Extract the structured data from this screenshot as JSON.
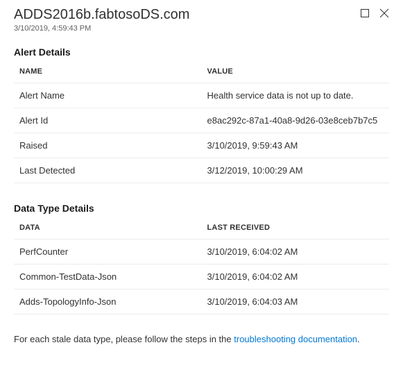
{
  "header": {
    "title": "ADDS2016b.fabtosoDS.com",
    "timestamp": "3/10/2019, 4:59:43 PM"
  },
  "alertDetails": {
    "title": "Alert Details",
    "columns": {
      "name": "NAME",
      "value": "VALUE"
    },
    "rows": [
      {
        "name": "Alert Name",
        "value": "Health service data is not up to date."
      },
      {
        "name": "Alert Id",
        "value": "e8ac292c-87a1-40a8-9d26-03e8ceb7b7c5"
      },
      {
        "name": "Raised",
        "value": "3/10/2019, 9:59:43 AM"
      },
      {
        "name": "Last Detected",
        "value": "3/12/2019, 10:00:29 AM"
      }
    ]
  },
  "dataTypeDetails": {
    "title": "Data Type Details",
    "columns": {
      "data": "DATA",
      "lastReceived": "LAST RECEIVED"
    },
    "rows": [
      {
        "data": "PerfCounter",
        "lastReceived": "3/10/2019, 6:04:02 AM"
      },
      {
        "data": "Common-TestData-Json",
        "lastReceived": "3/10/2019, 6:04:02 AM"
      },
      {
        "data": "Adds-TopologyInfo-Json",
        "lastReceived": "3/10/2019, 6:04:03 AM"
      }
    ]
  },
  "footer": {
    "prefix": "For each stale data type, please follow the steps in the ",
    "linkText": "troubleshooting documentation",
    "suffix": "."
  }
}
